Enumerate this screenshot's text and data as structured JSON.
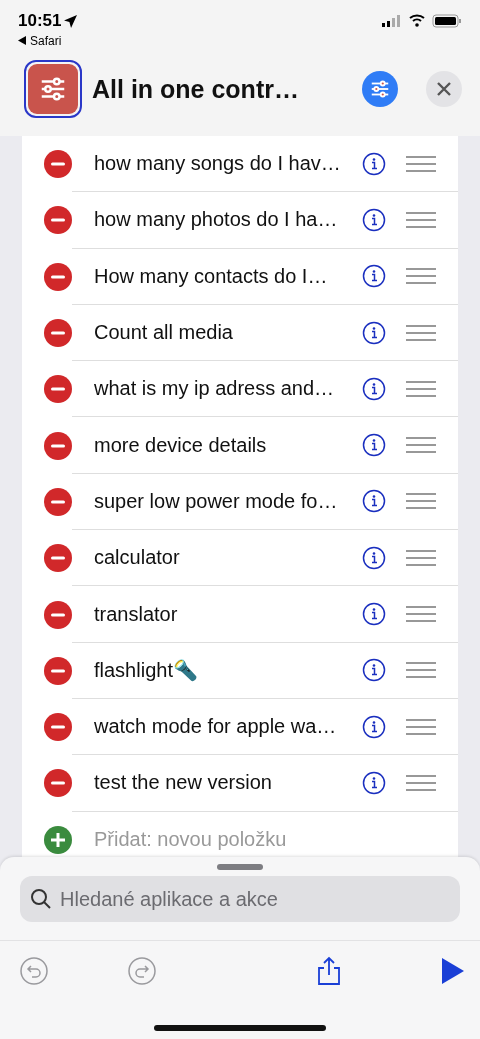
{
  "status_bar": {
    "time": "10:51",
    "back_label": "Safari"
  },
  "header": {
    "title": "All in one contr…"
  },
  "actions": [
    {
      "label": "how many songs do I hav…"
    },
    {
      "label": "how many photos do I ha…"
    },
    {
      "label": "How many contacts do I…"
    },
    {
      "label": "Count all media"
    },
    {
      "label": "what is my ip adress and…"
    },
    {
      "label": "more device details"
    },
    {
      "label": "super low power mode fo…"
    },
    {
      "label": "calculator"
    },
    {
      "label": "translator"
    },
    {
      "label": "flashlight🔦"
    },
    {
      "label": "watch mode for apple wa…"
    },
    {
      "label": "test the new version"
    }
  ],
  "add_item": {
    "label": "Přidat: novou položku"
  },
  "search": {
    "placeholder": "Hledané aplikace a akce"
  },
  "toolbar": [
    {
      "kind": "undo",
      "disabled": true
    },
    {
      "kind": "redo",
      "disabled": true
    },
    {
      "kind": "share",
      "disabled": false
    },
    {
      "kind": "run",
      "disabled": false
    }
  ]
}
